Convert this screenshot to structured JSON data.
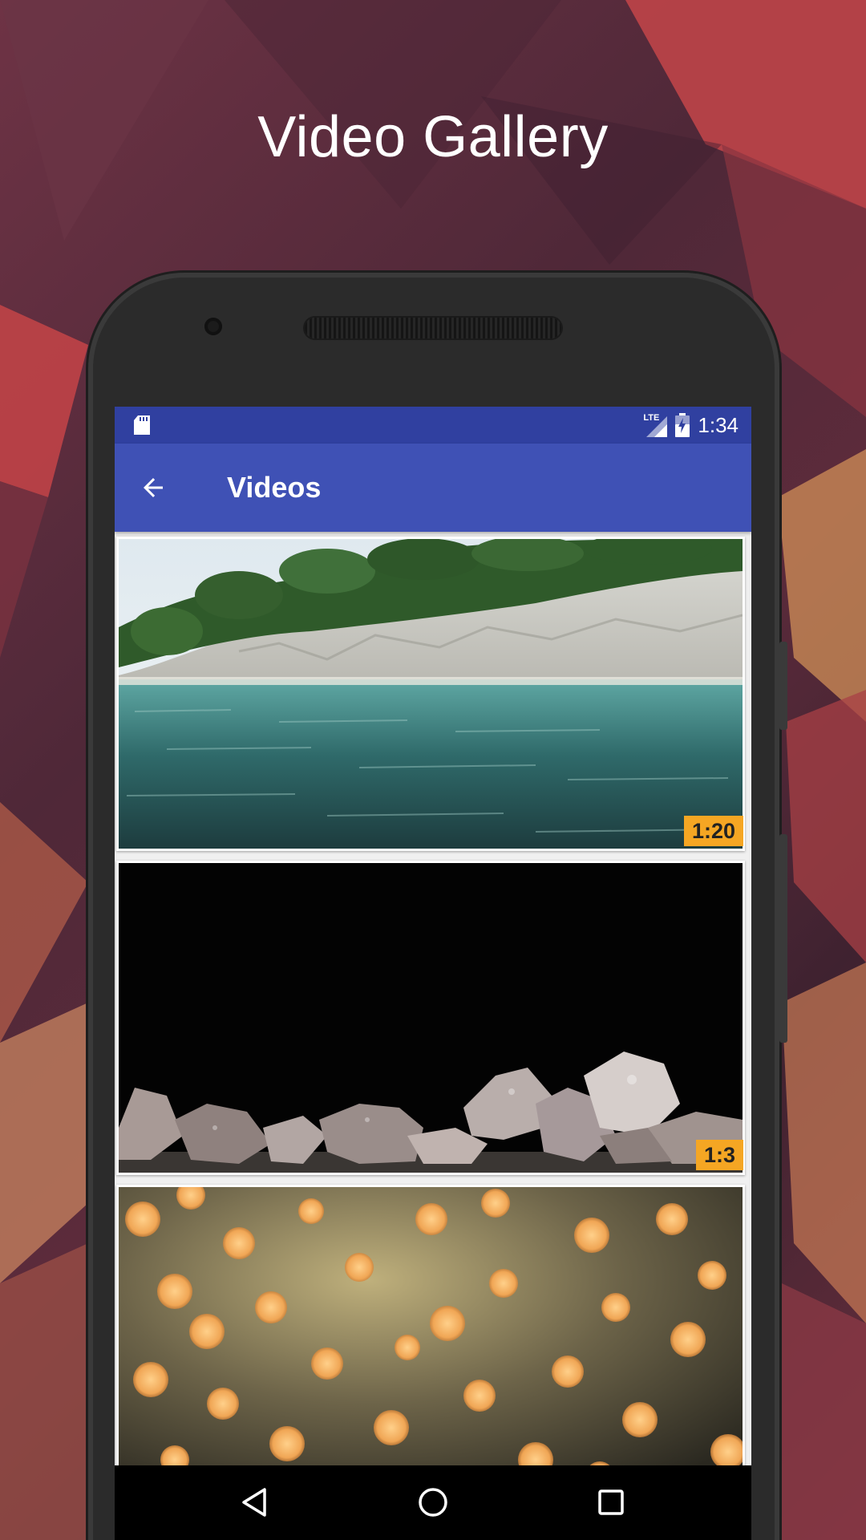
{
  "promo": {
    "headline": "Video Gallery"
  },
  "status_bar": {
    "network": "LTE",
    "time": "1:34",
    "icons": [
      "sd-card-icon",
      "signal-icon",
      "battery-charging-icon"
    ]
  },
  "app_bar": {
    "title": "Videos",
    "back_icon": "arrow-back-icon"
  },
  "videos": [
    {
      "thumbnail": "coastal-cliff-water",
      "duration": "1:20"
    },
    {
      "thumbnail": "ice-on-black",
      "duration": "1:3"
    },
    {
      "thumbnail": "golden-bokeh",
      "duration": ""
    }
  ],
  "nav_bar": {
    "icons": [
      "back-triangle-icon",
      "home-circle-icon",
      "recents-square-icon"
    ]
  },
  "colors": {
    "status_bar": "#3040a0",
    "app_bar": "#3f51b5",
    "duration_badge": "#f5a623",
    "background": "#5a2c3c"
  }
}
